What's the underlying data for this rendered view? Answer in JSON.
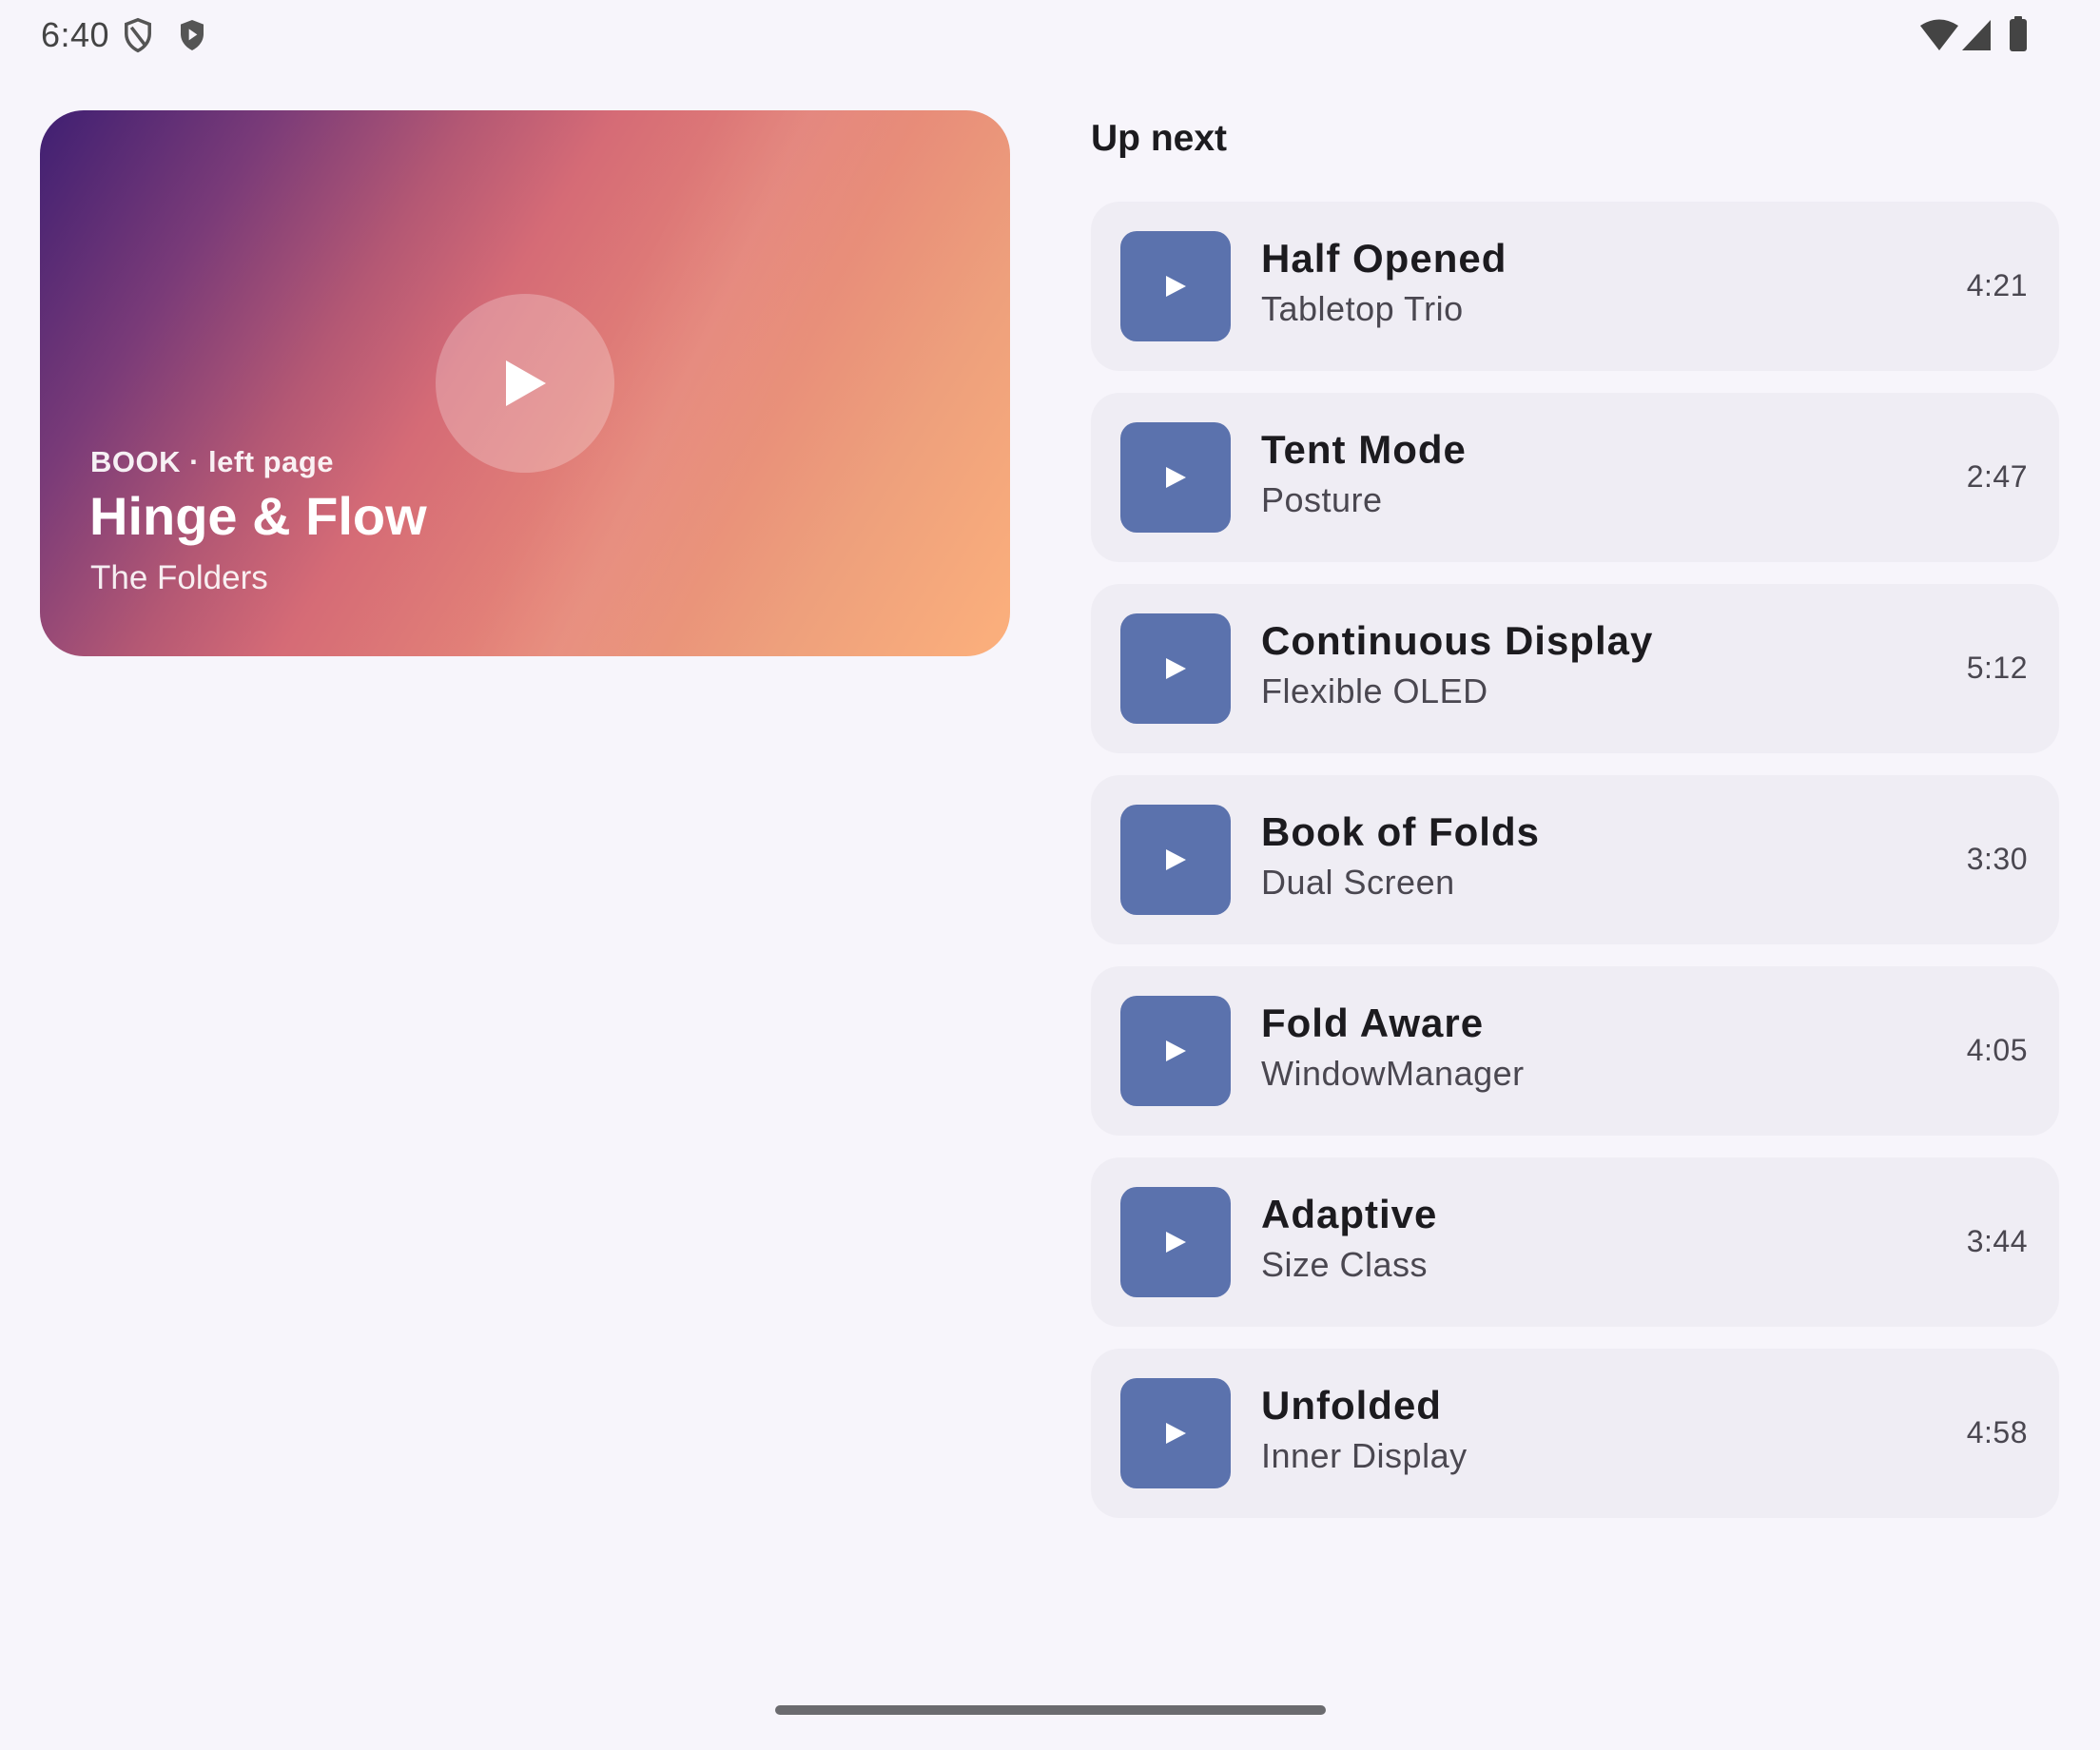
{
  "status_bar": {
    "time": "6:40",
    "left_icons": [
      "shield-outline-icon",
      "play-shield-icon"
    ],
    "right_icons": [
      "wifi-icon",
      "cellular-signal-icon",
      "battery-icon"
    ]
  },
  "hero": {
    "eyebrow": "BOOK · left page",
    "title": "Hinge & Flow",
    "subtitle": "The Folders",
    "play_icon": "play-icon",
    "gradient_colors": [
      "#3f1f72",
      "#d56b76",
      "#fcb07c"
    ]
  },
  "up_next": {
    "heading": "Up next",
    "thumb_color": "#5b72ad",
    "tracks": [
      {
        "title": "Half Opened",
        "artist": "Tabletop Trio",
        "duration": "4:21"
      },
      {
        "title": "Tent Mode",
        "artist": "Posture",
        "duration": "2:47"
      },
      {
        "title": "Continuous Display",
        "artist": "Flexible OLED",
        "duration": "5:12"
      },
      {
        "title": "Book of Folds",
        "artist": "Dual Screen",
        "duration": "3:30"
      },
      {
        "title": "Fold Aware",
        "artist": "WindowManager",
        "duration": "4:05"
      },
      {
        "title": "Adaptive",
        "artist": "Size Class",
        "duration": "3:44"
      },
      {
        "title": "Unfolded",
        "artist": "Inner Display",
        "duration": "4:58"
      }
    ]
  }
}
